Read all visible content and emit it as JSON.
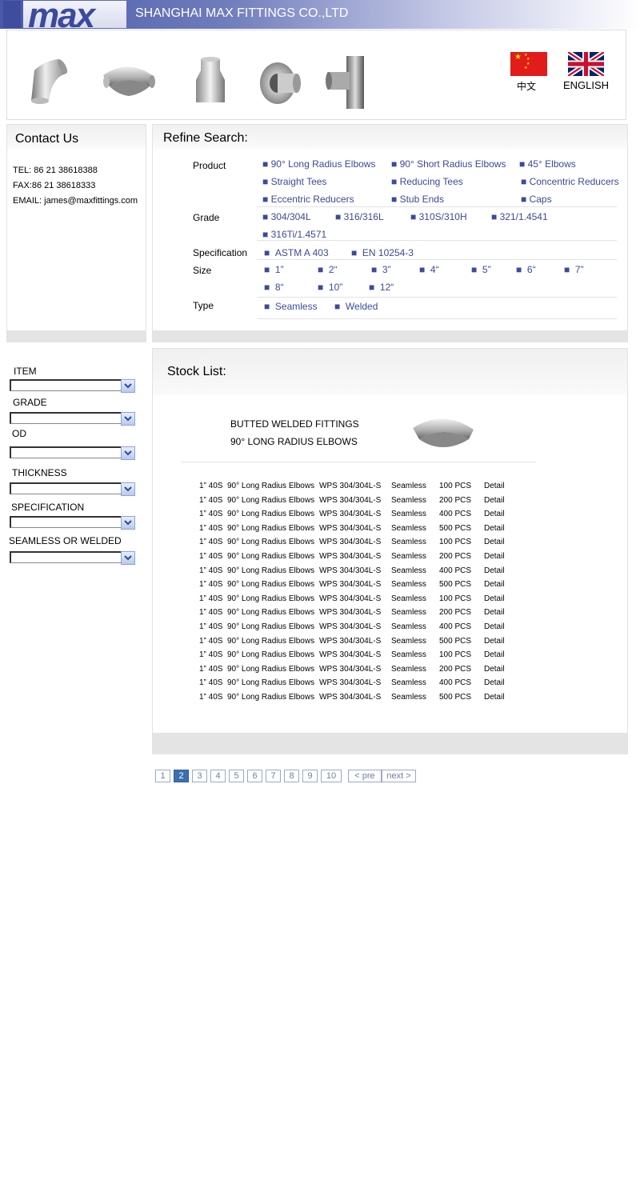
{
  "header": {
    "logo_text": "max",
    "company": "SHANGHAI MAX FITTINGS CO.,LTD"
  },
  "languages": {
    "chinese": "中文",
    "english": "ENGLISH"
  },
  "contact": {
    "title": "Contact Us",
    "tel": "TEL: 86 21 38618388",
    "fax": "FAX:86 21 38618333",
    "email": "EMAIL: james@maxfittings.com"
  },
  "refine": {
    "title": "Refine Search:",
    "labels": {
      "product": "Product",
      "grade": "Grade",
      "specification": "Specification",
      "size": "Size",
      "type": "Type"
    },
    "products": [
      "90° Long Radius Elbows",
      "90° Short Radius Elbows",
      "45°  Elbows",
      "Straight Tees",
      "Reducing Tees",
      "Concentric Reducers",
      "Eccentric Reducers",
      "Stub Ends",
      "Caps"
    ],
    "grades": [
      "304/304L",
      "316/316L",
      "310S/310H",
      "321/1.4541",
      "316Ti/1.4571"
    ],
    "specifications": [
      "ASTM A 403",
      "EN 10254-3"
    ],
    "sizes": [
      "1”",
      "2“",
      "3”",
      "4“",
      "5”",
      "6“",
      "7”",
      "8“",
      "10”",
      "12“"
    ],
    "types": [
      "Seamless",
      "Welded"
    ]
  },
  "filters": [
    {
      "label": "ITEM",
      "value": ""
    },
    {
      "label": "GRADE",
      "value": ""
    },
    {
      "label": "OD",
      "value": ""
    },
    {
      "label": "THICKNESS",
      "value": ""
    },
    {
      "label": "SPECIFICATION",
      "value": ""
    },
    {
      "label": "SEAMLESS OR WELDED",
      "value": ""
    }
  ],
  "stock": {
    "title": "Stock List:",
    "category_line1": "BUTTED WELDED FITTINGS",
    "category_line2": "90° LONG RADIUS ELBOWS",
    "rows": [
      {
        "size": "1” 40S",
        "product": "90° Long Radius Elbows",
        "grade": "WPS 304/304L-S",
        "type": "Seamless",
        "qty": "100 PCS",
        "link": "Detail"
      },
      {
        "size": "1” 40S",
        "product": "90° Long Radius Elbows",
        "grade": "WPS 304/304L-S",
        "type": "Seamless",
        "qty": "200 PCS",
        "link": "Detail"
      },
      {
        "size": "1” 40S",
        "product": "90° Long Radius Elbows",
        "grade": "WPS 304/304L-S",
        "type": "Seamless",
        "qty": "400 PCS",
        "link": "Detail"
      },
      {
        "size": "1” 40S",
        "product": "90° Long Radius Elbows",
        "grade": "WPS 304/304L-S",
        "type": "Seamless",
        "qty": "500 PCS",
        "link": "Detail"
      },
      {
        "size": "1” 40S",
        "product": "90° Long Radius Elbows",
        "grade": "WPS 304/304L-S",
        "type": "Seamless",
        "qty": "100 PCS",
        "link": "Detail"
      },
      {
        "size": "1” 40S",
        "product": "90° Long Radius Elbows",
        "grade": "WPS 304/304L-S",
        "type": "Seamless",
        "qty": "200 PCS",
        "link": "Detail"
      },
      {
        "size": "1” 40S",
        "product": "90° Long Radius Elbows",
        "grade": "WPS 304/304L-S",
        "type": "Seamless",
        "qty": "400 PCS",
        "link": "Detail"
      },
      {
        "size": "1” 40S",
        "product": "90° Long Radius Elbows",
        "grade": "WPS 304/304L-S",
        "type": "Seamless",
        "qty": "500 PCS",
        "link": "Detail"
      },
      {
        "size": "1” 40S",
        "product": "90° Long Radius Elbows",
        "grade": "WPS 304/304L-S",
        "type": "Seamless",
        "qty": "100 PCS",
        "link": "Detail"
      },
      {
        "size": "1” 40S",
        "product": "90° Long Radius Elbows",
        "grade": "WPS 304/304L-S",
        "type": "Seamless",
        "qty": "200 PCS",
        "link": "Detail"
      },
      {
        "size": "1” 40S",
        "product": "90° Long Radius Elbows",
        "grade": "WPS 304/304L-S",
        "type": "Seamless",
        "qty": "400 PCS",
        "link": "Detail"
      },
      {
        "size": "1” 40S",
        "product": "90° Long Radius Elbows",
        "grade": "WPS 304/304L-S",
        "type": "Seamless",
        "qty": "500 PCS",
        "link": "Detail"
      },
      {
        "size": "1” 40S",
        "product": "90° Long Radius Elbows",
        "grade": "WPS 304/304L-S",
        "type": "Seamless",
        "qty": "100 PCS",
        "link": "Detail"
      },
      {
        "size": "1” 40S",
        "product": "90° Long Radius Elbows",
        "grade": "WPS 304/304L-S",
        "type": "Seamless",
        "qty": "200 PCS",
        "link": "Detail"
      },
      {
        "size": "1” 40S",
        "product": "90° Long Radius Elbows",
        "grade": "WPS 304/304L-S",
        "type": "Seamless",
        "qty": "400 PCS",
        "link": "Detail"
      },
      {
        "size": "1” 40S",
        "product": "90° Long Radius Elbows",
        "grade": "WPS 304/304L-S",
        "type": "Seamless",
        "qty": "500 PCS",
        "link": "Detail"
      }
    ]
  },
  "pagination": {
    "pages": [
      "1",
      "2",
      "3",
      "4",
      "5",
      "6",
      "7",
      "8",
      "9",
      "10"
    ],
    "current": "2",
    "prev": "< pre",
    "next": "next >"
  },
  "colors": {
    "brand_blue": "#3e4d9e",
    "link_blue": "#3b4a99",
    "current_page": "#3b6fb0"
  }
}
